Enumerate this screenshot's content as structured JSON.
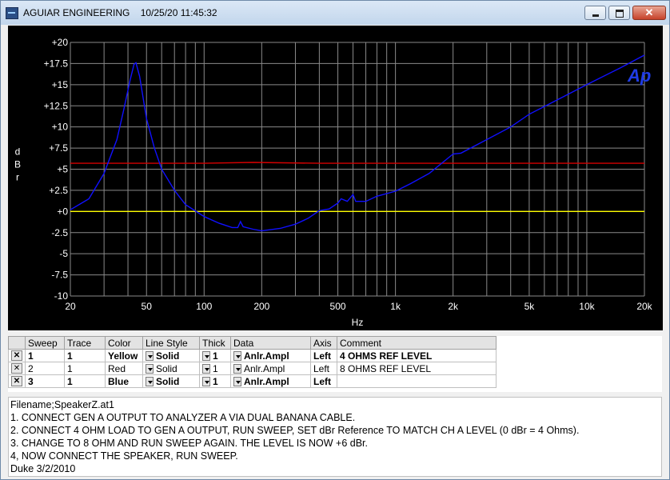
{
  "window": {
    "title": "AGUIAR ENGINEERING    10/25/20 11:45:32",
    "min_label": "",
    "max_label": "",
    "close_label": ""
  },
  "chart_data": {
    "type": "line",
    "x_scale": "log",
    "xlim": [
      20,
      20000
    ],
    "ylim": [
      -10,
      20
    ],
    "xlabel": "Hz",
    "ylabel": "d B r",
    "y_ticks": [
      "+20",
      "+17.5",
      "+15",
      "+12.5",
      "+10",
      "+7.5",
      "+5",
      "+2.5",
      "+0",
      "-2.5",
      "-5",
      "-7.5",
      "-10"
    ],
    "y_tick_values": [
      20,
      17.5,
      15,
      12.5,
      10,
      7.5,
      5,
      2.5,
      0,
      -2.5,
      -5,
      -7.5,
      -10
    ],
    "x_ticks": [
      "20",
      "50",
      "100",
      "200",
      "500",
      "1k",
      "2k",
      "5k",
      "10k",
      "20k"
    ],
    "x_tick_values": [
      20,
      50,
      100,
      200,
      500,
      1000,
      2000,
      5000,
      10000,
      20000
    ],
    "grid": true,
    "background": "#000000",
    "series": [
      {
        "color": "#ffff00",
        "points": [
          [
            20,
            0
          ],
          [
            20000,
            0
          ]
        ]
      },
      {
        "color": "#d40000",
        "points": [
          [
            20,
            5.7
          ],
          [
            100,
            5.7
          ],
          [
            180,
            5.8
          ],
          [
            400,
            5.7
          ],
          [
            1000,
            5.7
          ],
          [
            20000,
            5.7
          ]
        ]
      },
      {
        "color": "#1010ff",
        "points": [
          [
            20,
            0.2
          ],
          [
            25,
            1.5
          ],
          [
            30,
            4.5
          ],
          [
            35,
            8.5
          ],
          [
            38,
            12.0
          ],
          [
            41,
            15.5
          ],
          [
            43,
            17.4
          ],
          [
            44,
            17.6
          ],
          [
            46,
            16.0
          ],
          [
            50,
            11.0
          ],
          [
            55,
            7.5
          ],
          [
            60,
            5.0
          ],
          [
            70,
            2.5
          ],
          [
            80,
            0.8
          ],
          [
            100,
            -0.6
          ],
          [
            120,
            -1.4
          ],
          [
            140,
            -1.9
          ],
          [
            150,
            -1.9
          ],
          [
            155,
            -1.2
          ],
          [
            160,
            -1.8
          ],
          [
            180,
            -2.1
          ],
          [
            200,
            -2.3
          ],
          [
            250,
            -2.0
          ],
          [
            300,
            -1.5
          ],
          [
            350,
            -0.8
          ],
          [
            400,
            0.1
          ],
          [
            450,
            0.3
          ],
          [
            500,
            1.0
          ],
          [
            520,
            1.5
          ],
          [
            560,
            1.2
          ],
          [
            600,
            2.0
          ],
          [
            620,
            1.2
          ],
          [
            700,
            1.2
          ],
          [
            800,
            1.8
          ],
          [
            1000,
            2.4
          ],
          [
            1200,
            3.3
          ],
          [
            1500,
            4.5
          ],
          [
            2000,
            6.8
          ],
          [
            2200,
            6.9
          ],
          [
            3000,
            8.5
          ],
          [
            4000,
            10.0
          ],
          [
            5000,
            11.5
          ],
          [
            7000,
            13.2
          ],
          [
            10000,
            15.0
          ],
          [
            15000,
            17.0
          ],
          [
            20000,
            18.5
          ]
        ]
      }
    ],
    "logo": "Ap"
  },
  "table": {
    "headers": [
      "",
      "Sweep",
      "Trace",
      "Color",
      "Line Style",
      "Thick",
      "Data",
      "Axis",
      "Comment"
    ],
    "rows": [
      {
        "check": "✕",
        "sweep": "1",
        "trace": "1",
        "color": "Yellow",
        "line_style": "Solid",
        "thick": "1",
        "data": "Anlr.Ampl",
        "axis": "Left",
        "comment": "4 OHMS REF LEVEL",
        "bold": true
      },
      {
        "check": "✕",
        "sweep": "2",
        "trace": "1",
        "color": "Red",
        "line_style": "Solid",
        "thick": "1",
        "data": "Anlr.Ampl",
        "axis": "Left",
        "comment": "8 OHMS REF LEVEL",
        "bold": false
      },
      {
        "check": "✕",
        "sweep": "3",
        "trace": "1",
        "color": "Blue",
        "line_style": "Solid",
        "thick": "1",
        "data": "Anlr.Ampl",
        "axis": "Left",
        "comment": "",
        "bold": true
      }
    ]
  },
  "notes": [
    "Filename;SpeakerZ.at1",
    "1. CONNECT GEN A OUTPUT TO ANALYZER A VIA DUAL BANANA CABLE.",
    "2. CONNECT 4 OHM LOAD TO GEN A OUTPUT, RUN SWEEP, SET dBr Reference TO MATCH CH A LEVEL (0 dBr = 4 Ohms).",
    "3. CHANGE TO 8 OHM AND RUN SWEEP AGAIN. THE LEVEL IS NOW +6 dBr.",
    "4, NOW CONNECT THE SPEAKER, RUN SWEEP.",
    "Duke 3/2/2010"
  ]
}
